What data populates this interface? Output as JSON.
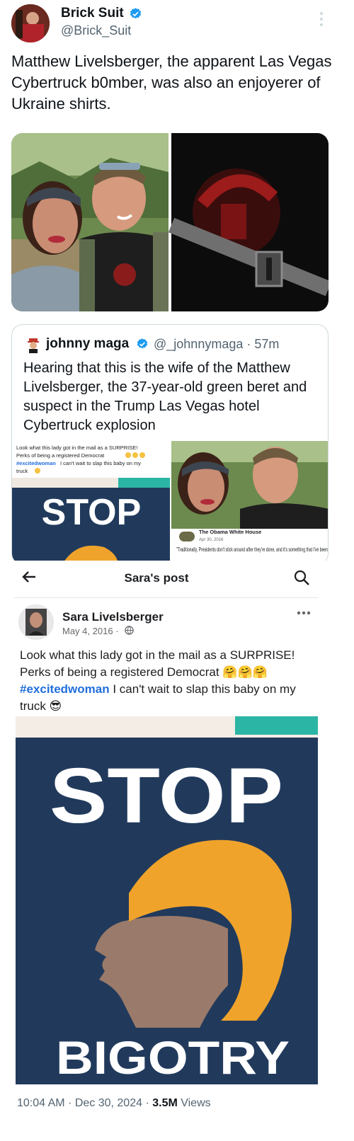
{
  "tweet": {
    "author_name": "Brick Suit",
    "author_handle": "@Brick_Suit",
    "text": "Matthew Livelsberger, the apparent Las Vegas Cybertruck b0mber, was also an enjoyerer of Ukraine shirts."
  },
  "quoted_tweet": {
    "author_name": "johnny maga",
    "author_handle": "@_johnnymaga",
    "time": "57m",
    "text": "Hearing that this is the wife of the Matthew Livelsberger, the 37-year-old green beret and suspect in the Trump Las Vegas hotel Cybertruck explosion",
    "embedded_post_text_1": "Look what this lady got in the mail as a SURPRISE!",
    "embedded_post_text_2": "Perks of being a registered Democrat",
    "embedded_post_tag": "#excitedwoman",
    "embedded_post_text_3": "I can't wait to slap this baby on my",
    "embedded_post_text_4": "truck",
    "sign_word": "STOP",
    "side_source": "The Obama White House",
    "side_date": "Apr 30, 2016",
    "side_quote": "\"Traditionally, Presidents don't stick around after they're done, and it's something that I've been"
  },
  "fb_post": {
    "header_title": "Sara's post",
    "author_name": "Sara Livelsberger",
    "date": "May 4, 2016",
    "text_1": "Look what this lady got in the mail as a SURPRISE! Perks of being a registered Democrat 🤗🤗🤗",
    "tag": "#excitedwoman",
    "text_2": " I can't wait to slap this baby on my truck 😎",
    "sign_top": "STOP",
    "sign_bottom": "BIGOTRY"
  },
  "footer": {
    "timestamp": "10:04 AM · Dec 30, 2024 · ",
    "views_count": "3.5M",
    "views_label": " Views"
  },
  "colors": {
    "verified_blue": "#1d9bf0",
    "sign_navy": "#213a5c",
    "hair_orange": "#f0a32b",
    "link_blue": "#216fdb"
  }
}
